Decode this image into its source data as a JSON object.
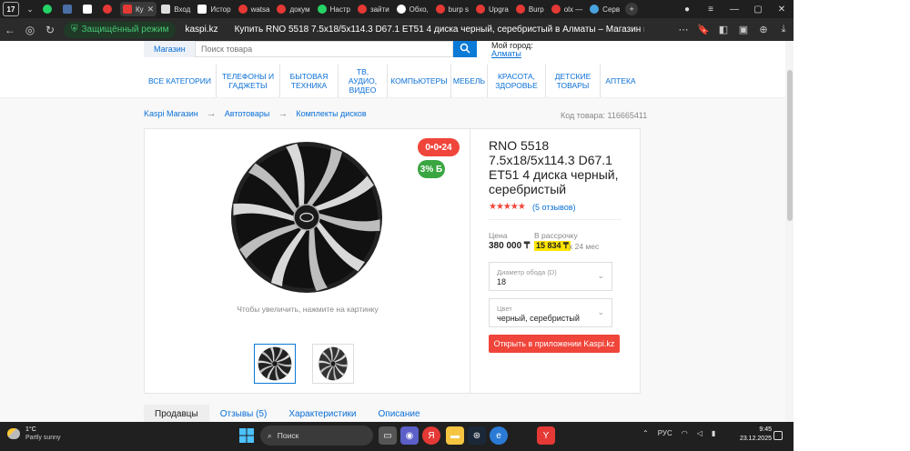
{
  "browser": {
    "tab_counter": "17",
    "tabs": [
      {
        "label": "",
        "icon": "whatsapp-icon"
      },
      {
        "label": "",
        "icon": "wallet-icon"
      },
      {
        "label": "",
        "icon": "document-icon"
      },
      {
        "label": "",
        "icon": "yandex-icon"
      },
      {
        "label": "Ку",
        "icon": "kaspi-icon",
        "active": true
      },
      {
        "label": "Вход",
        "icon": "gmail-icon"
      },
      {
        "label": "Истор",
        "icon": "document-icon"
      },
      {
        "label": "watsa",
        "icon": "yandex-icon"
      },
      {
        "label": "докум",
        "icon": "yandex-icon"
      },
      {
        "label": "Настр",
        "icon": "whatsapp-icon"
      },
      {
        "label": "зайти",
        "icon": "yandex-icon"
      },
      {
        "label": "Обхо,",
        "icon": "github-icon"
      },
      {
        "label": "burp s",
        "icon": "yandex-icon"
      },
      {
        "label": "Upgra",
        "icon": "yandex-icon"
      },
      {
        "label": "Burp",
        "icon": "yandex-icon"
      },
      {
        "label": "olx —",
        "icon": "yandex-icon"
      },
      {
        "label": "Серв",
        "icon": "generic-icon"
      }
    ],
    "secure_label": "Защищённый режим",
    "domain": "kaspi.kz",
    "page_title": "Купить RNO 5518 7.5x18/5x114.3 D67.1 ET51 4 диска черный, серебристый в Алматы – Магазин на Kaspi.kz"
  },
  "header": {
    "store_label": "Магазин",
    "search_placeholder": "Поиск товара",
    "city_label": "Мой город:",
    "city_value": "Алматы"
  },
  "nav": [
    "ВСЕ КАТЕГОРИИ",
    "ТЕЛЕФОНЫ И ГАДЖЕТЫ",
    "БЫТОВАЯ ТЕХНИКА",
    "ТВ, АУДИО, ВИДЕО",
    "КОМПЬЮТЕРЫ",
    "МЕБЕЛЬ",
    "КРАСОТА, ЗДОРОВЬЕ",
    "ДЕТСКИЕ ТОВАРЫ",
    "АПТЕКА"
  ],
  "breadcrumb": [
    "Kaspi Магазин",
    "Автотовары",
    "Комплекты дисков"
  ],
  "product": {
    "code_label": "Код товара: 116665411",
    "title": "RNO 5518 7.5x18/5x114.3 D67.1 ET51 4 диска черный, серебристый",
    "rating_stars": "★★★★★",
    "reviews": "(5 отзывов)",
    "badge_installment": "0•0•24",
    "badge_bonus": "3% Б",
    "zoom_hint": "Чтобы увеличить, нажмите на картинку",
    "price_label": "Цена",
    "price": "380 000 ₸",
    "installment_label": "В рассрочку",
    "installment_price": "15 834 ₸",
    "installment_term": "x 24 мес",
    "diameter_label": "Диаметр обода (D)",
    "diameter_value": "18",
    "color_label": "Цвет",
    "color_value": "черный, серебристый",
    "open_app_button": "Открыть в приложении Kaspi.kz"
  },
  "tabs": [
    "Продавцы",
    "Отзывы (5)",
    "Характеристики",
    "Описание"
  ],
  "taskbar": {
    "temperature": "1°C",
    "condition": "Partly sunny",
    "search_label": "Поиск",
    "language": "РУС",
    "time": "9:45",
    "date": "23.12.2025"
  },
  "colors": {
    "accent_blue": "#0a7ad7",
    "accent_red": "#f0453a",
    "yellow_highlight": "#ffe500",
    "green_badge": "#3aa641"
  }
}
